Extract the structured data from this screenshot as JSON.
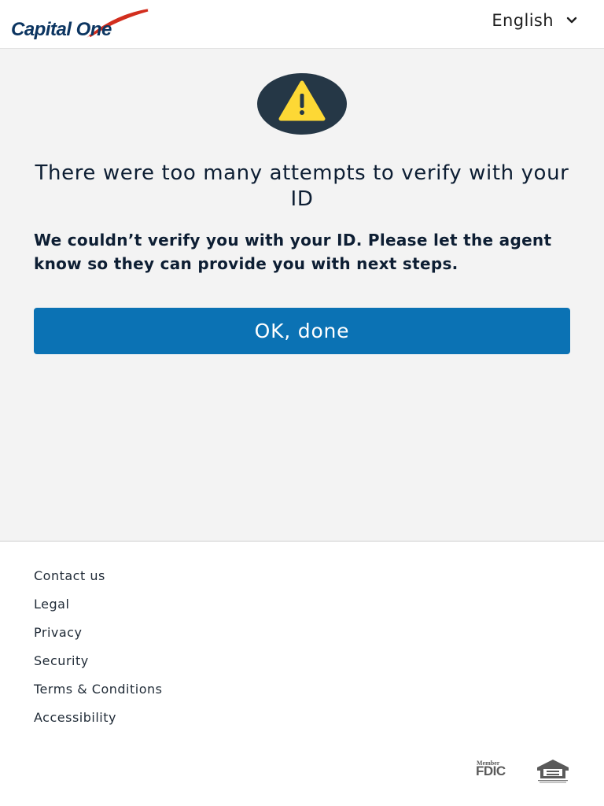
{
  "header": {
    "logo_text": "Capital One",
    "language": "English"
  },
  "main": {
    "icon": "warning-icon",
    "headline": "There were too many attempts to verify with your ID",
    "message": "We couldn’t verify you with your ID. Please let the agent know so they can provide you with next steps.",
    "ok_button_label": "OK, done"
  },
  "footer": {
    "links": [
      {
        "label": "Contact us"
      },
      {
        "label": "Legal"
      },
      {
        "label": "Privacy"
      },
      {
        "label": "Security"
      },
      {
        "label": "Terms & Conditions"
      },
      {
        "label": "Accessibility"
      }
    ],
    "fdic_small": "Member",
    "fdic_big": "FDIC",
    "eho_icon": "equal-housing-opportunity-icon"
  },
  "colors": {
    "brand_navy": "#0c3561",
    "brand_red": "#d22e1e",
    "button_blue": "#0b72b4",
    "warning_yellow": "#fdd835",
    "warning_circle": "#253746",
    "page_bg": "#f3f3f3"
  }
}
